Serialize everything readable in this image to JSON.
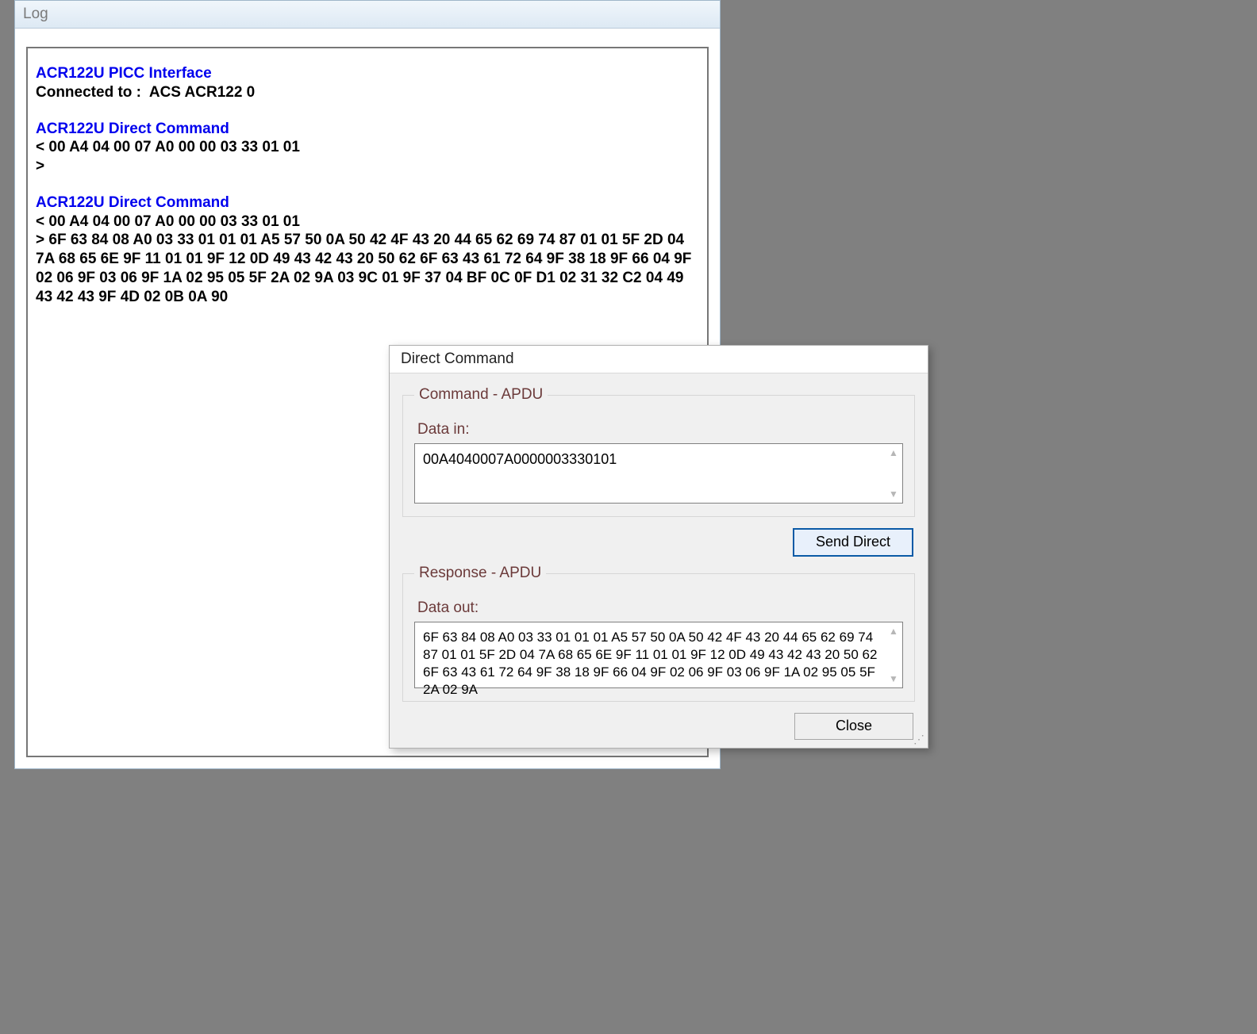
{
  "log_window": {
    "title": "Log",
    "entries": [
      {
        "type": "head",
        "text": "ACR122U PICC Interface"
      },
      {
        "type": "text",
        "text": "Connected to :  ACS ACR122 0"
      },
      {
        "type": "blank"
      },
      {
        "type": "head",
        "text": "ACR122U Direct Command"
      },
      {
        "type": "text",
        "text": "< 00 A4 04 00 07 A0 00 00 03 33 01 01"
      },
      {
        "type": "text",
        "text": ">"
      },
      {
        "type": "blank"
      },
      {
        "type": "head",
        "text": "ACR122U Direct Command"
      },
      {
        "type": "text",
        "text": "< 00 A4 04 00 07 A0 00 00 03 33 01 01"
      },
      {
        "type": "text",
        "text": "> 6F 63 84 08 A0 03 33 01 01 01 A5 57 50 0A 50 42 4F 43 20 44 65 62 69 74 87 01 01 5F 2D 04 7A 68 65 6E 9F 11 01 01 9F 12 0D 49 43 42 43 20 50 62 6F 63 43 61 72 64 9F 38 18 9F 66 04 9F 02 06 9F 03 06 9F 1A 02 95 05 5F 2A 02 9A 03 9C 01 9F 37 04 BF 0C 0F D1 02 31 32 C2 04 49 43 42 43 9F 4D 02 0B 0A 90"
      }
    ]
  },
  "dialog": {
    "title": "Direct Command",
    "command_group": {
      "legend": "Command - APDU",
      "data_in_label": "Data in:",
      "data_in_value": "00A4040007A0000003330101"
    },
    "send_button_label": "Send Direct",
    "response_group": {
      "legend": "Response - APDU",
      "data_out_label": "Data out:",
      "data_out_value": "6F 63 84 08 A0 03 33 01 01 01 A5 57 50 0A 50 42 4F 43 20 44 65 62 69 74 87 01 01 5F 2D 04 7A 68 65 6E 9F 11 01 01 9F 12 0D 49 43 42 43 20 50 62 6F 63 43 61 72 64 9F 38 18 9F 66 04 9F 02 06 9F 03 06 9F 1A 02 95 05 5F 2A 02 9A"
    },
    "close_button_label": "Close"
  }
}
